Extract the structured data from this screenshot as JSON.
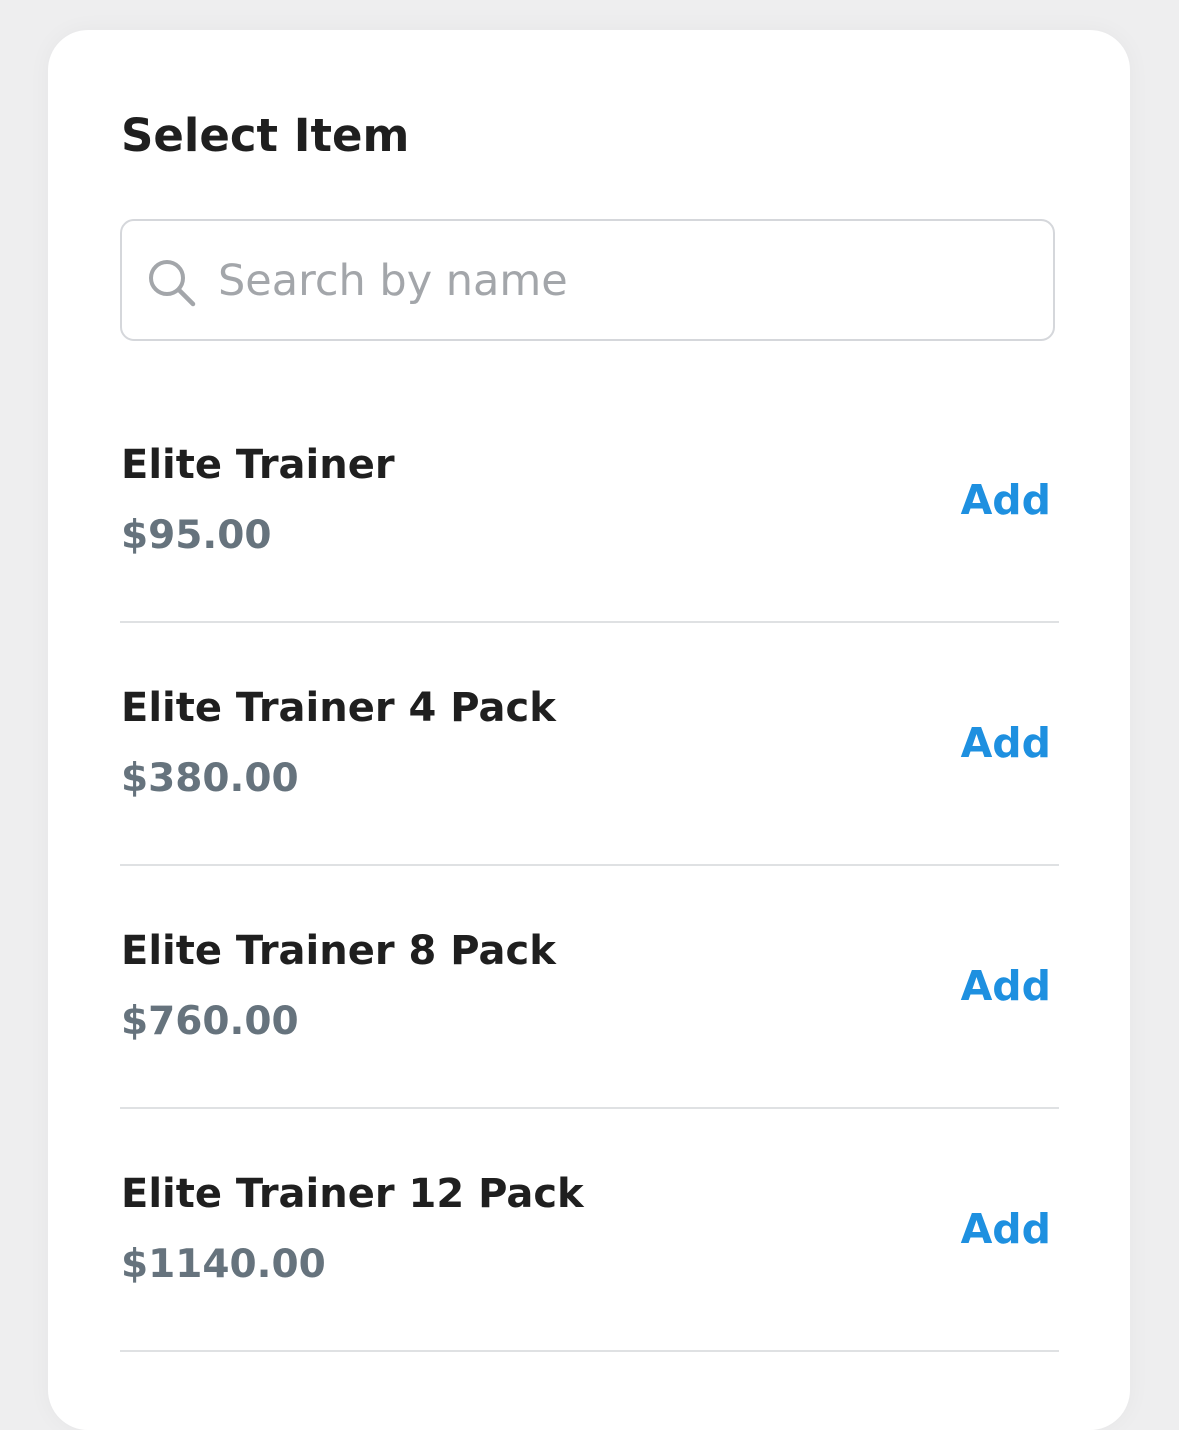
{
  "title": "Select Item",
  "search": {
    "placeholder": "Search by name",
    "value": "",
    "icon": "search-icon"
  },
  "items": [
    {
      "name": "Elite Trainer",
      "price": "$95.00",
      "action": "Add"
    },
    {
      "name": "Elite Trainer 4 Pack",
      "price": "$380.00",
      "action": "Add"
    },
    {
      "name": "Elite Trainer 8 Pack",
      "price": "$760.00",
      "action": "Add"
    },
    {
      "name": "Elite Trainer 12 Pack",
      "price": "$1140.00",
      "action": "Add"
    }
  ],
  "colors": {
    "accent": "#1e90e0",
    "price": "#66737d",
    "text": "#1f1f1f",
    "background": "#eeeeef"
  }
}
